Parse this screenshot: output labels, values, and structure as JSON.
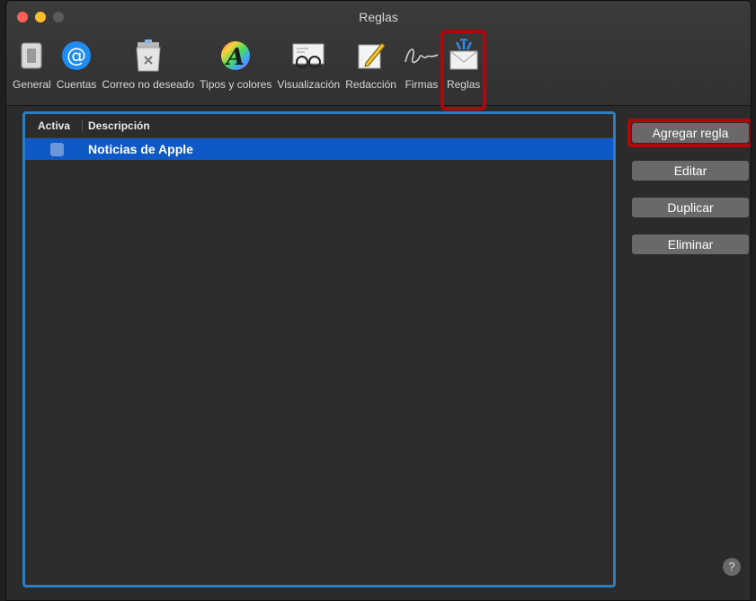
{
  "window": {
    "title": "Reglas"
  },
  "toolbar": {
    "items": [
      {
        "label": "General",
        "icon": "general-switch-icon"
      },
      {
        "label": "Cuentas",
        "icon": "at-sign-icon"
      },
      {
        "label": "Correo no deseado",
        "icon": "junk-trash-icon"
      },
      {
        "label": "Tipos y colores",
        "icon": "fonts-colors-icon"
      },
      {
        "label": "Visualización",
        "icon": "glasses-icon"
      },
      {
        "label": "Redacción",
        "icon": "pencil-compose-icon"
      },
      {
        "label": "Firmas",
        "icon": "signature-icon"
      },
      {
        "label": "Reglas",
        "icon": "rules-envelope-icon",
        "selected": true
      }
    ]
  },
  "table": {
    "columns": [
      "Activa",
      "Descripción"
    ],
    "rows": [
      {
        "active": false,
        "description": "Noticias de Apple",
        "selected": true
      }
    ]
  },
  "actions": {
    "add": "Agregar regla",
    "edit": "Editar",
    "duplicate": "Duplicar",
    "delete": "Eliminar"
  },
  "help": {
    "label": "?"
  },
  "colors": {
    "selection": "#0f59c7",
    "highlight": "#b5050c",
    "focus_ring": "#2b7ec2"
  }
}
